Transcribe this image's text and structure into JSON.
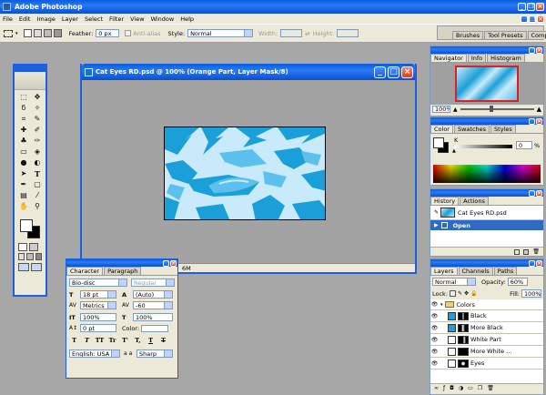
{
  "app": {
    "title": "Adobe Photoshop"
  },
  "menu": [
    "File",
    "Edit",
    "Image",
    "Layer",
    "Select",
    "Filter",
    "View",
    "Window",
    "Help"
  ],
  "options": {
    "feather_label": "Feather:",
    "feather_value": "0 px",
    "antialias_label": "Anti-alias",
    "style_label": "Style:",
    "style_value": "Normal",
    "width_label": "Width:",
    "height_label": "Height:"
  },
  "well_tabs": [
    "Brushes",
    "Tool Presets",
    "Comps"
  ],
  "document": {
    "title": "Cat Eyes RD.psd @ 100% (Orange Part, Layer Mask/8)",
    "status": "6M",
    "colors": {
      "light": "#c9eafb",
      "mid": "#5cc0ec",
      "dark": "#1a9fd8"
    }
  },
  "navigator": {
    "tabs": [
      "Navigator",
      "Info",
      "Histogram"
    ],
    "zoom": "100%"
  },
  "color": {
    "tabs": [
      "Color",
      "Swatches",
      "Styles"
    ],
    "channel": "K",
    "value": "0",
    "unit": "%"
  },
  "history": {
    "tabs": [
      "History",
      "Actions"
    ],
    "snapshot": "Cat Eyes RD.psd",
    "step": "Open"
  },
  "layers": {
    "tabs": [
      "Layers",
      "Channels",
      "Paths"
    ],
    "blend": "Normal",
    "opacity_label": "Opacity:",
    "opacity": "60%",
    "lock_label": "Lock:",
    "fill_label": "Fill:",
    "fill": "100%",
    "group": "Colors",
    "items": [
      "Black",
      "More Black",
      "White Part",
      "More White ...",
      "Eyes"
    ]
  },
  "character": {
    "tabs": [
      "Character",
      "Paragraph"
    ],
    "font": "Bio-disc",
    "style": "Regular",
    "size": "18 pt",
    "leading": "(Auto)",
    "kerning": "Metrics",
    "tracking": "-60",
    "vscale": "100%",
    "hscale": "100%",
    "baseline": "0 pt",
    "color_label": "Color:",
    "language": "English: USA",
    "aa_label": "a a",
    "aa": "Sharp",
    "styles": [
      "T",
      "T",
      "TT",
      "Tr",
      "T'",
      "T,",
      "T",
      "T"
    ]
  }
}
